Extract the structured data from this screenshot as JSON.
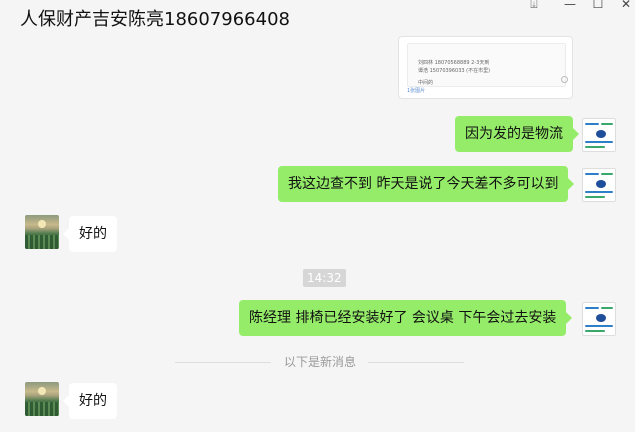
{
  "window": {
    "title": "人保财产吉安陈亮18607966408",
    "controls": {
      "pin": "⍗",
      "minimize": "—",
      "maximize": "☐",
      "close": "✕"
    }
  },
  "attachment_card": {
    "lines": [
      "刘四林 18070568889 2-3天到",
      "谭浩 15070396033 (不在市里)",
      "中间的"
    ],
    "footer": "1张图片"
  },
  "messages": [
    {
      "side": "self",
      "text": "因为发的是物流"
    },
    {
      "side": "self",
      "text": "我这边查不到  昨天是说了今天差不多可以到"
    },
    {
      "side": "other",
      "text": "好的"
    },
    {
      "side": "time",
      "text": "14:32"
    },
    {
      "side": "self",
      "text": "陈经理  排椅已经安装好了  会议桌 下午会过去安装"
    },
    {
      "side": "separator",
      "text": "以下是新消息"
    },
    {
      "side": "other",
      "text": "好的"
    }
  ],
  "colors": {
    "self_bubble": "#95ec69",
    "other_bubble": "#ffffff",
    "background": "#f5f5f5"
  },
  "icons": {
    "self_avatar": "company-logo-avatar",
    "other_avatar": "sunset-field-avatar"
  }
}
